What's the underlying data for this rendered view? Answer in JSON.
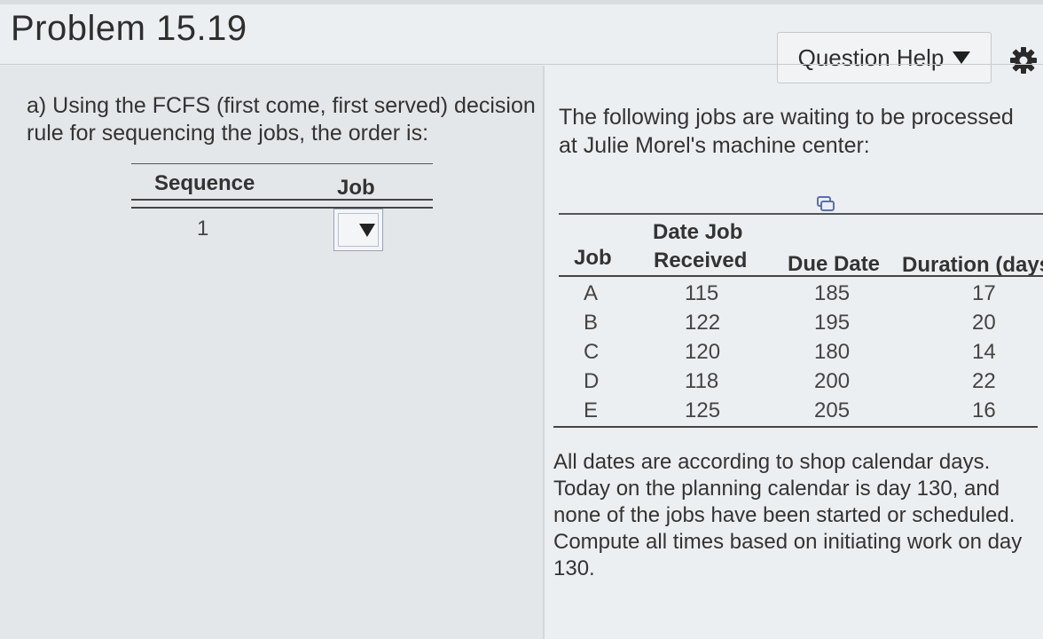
{
  "header": {
    "title": "Problem 15.19",
    "help_label": "Question Help"
  },
  "left": {
    "question": "a) Using the FCFS (first come, first served) decision rule for sequencing the jobs, the order is:",
    "seq_table": {
      "col_sequence": "Sequence",
      "col_job": "Job",
      "row_number": "1",
      "selected_job": ""
    }
  },
  "right": {
    "intro": "The following jobs are waiting to be processed at Julie Morel's machine center:",
    "jobs_table": {
      "headers": {
        "job": "Job",
        "received_line1": "Date Job",
        "received_line2": "Received",
        "due": "Due Date",
        "duration": "Duration (days)"
      },
      "rows": [
        {
          "job": "A",
          "received": "115",
          "due": "185",
          "duration": "17"
        },
        {
          "job": "B",
          "received": "122",
          "due": "195",
          "duration": "20"
        },
        {
          "job": "C",
          "received": "120",
          "due": "180",
          "duration": "14"
        },
        {
          "job": "D",
          "received": "118",
          "due": "200",
          "duration": "22"
        },
        {
          "job": "E",
          "received": "125",
          "due": "205",
          "duration": "16"
        }
      ]
    },
    "note": "All dates are according to shop calendar days. Today on the planning calendar is day 130, and none of the jobs have been started or scheduled. Compute all times based on initiating work on day 130."
  },
  "icons": {
    "help_caret": "caret-down-icon",
    "settings": "gear-icon",
    "copy": "copy-icon",
    "select_caret": "dropdown-caret-icon"
  }
}
